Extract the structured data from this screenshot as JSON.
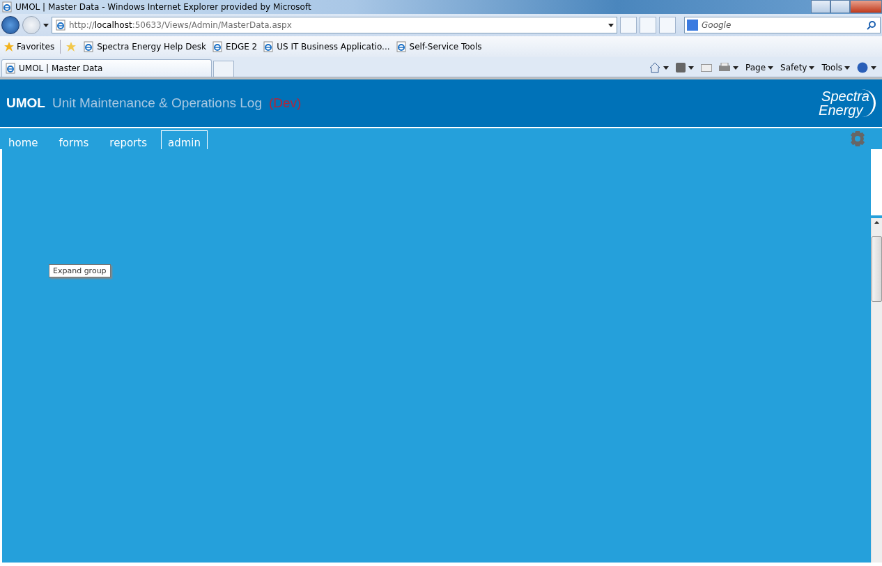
{
  "window": {
    "title": "UMOL | Master Data - Windows Internet Explorer provided by Microsoft"
  },
  "address_bar": {
    "url_prefix": "http://",
    "url_host": "localhost",
    "url_rest": ":50633/Views/Admin/MasterData.aspx"
  },
  "search": {
    "placeholder": "Google"
  },
  "favorites_bar": {
    "label": "Favorites",
    "links": [
      "Spectra Energy Help Desk",
      "EDGE 2",
      "US IT Business Applicatio...",
      "Self-Service Tools"
    ]
  },
  "tabs": [
    {
      "label": "UMOL | Master Data",
      "selected": true
    }
  ],
  "command_bar": [
    "Page",
    "Safety",
    "Tools"
  ],
  "app": {
    "brand": "UMOL",
    "title": "Unit Maintenance & Operations Log",
    "environment": "(Dev)",
    "logo_lines": [
      "Spectra",
      "Energy"
    ]
  },
  "nav": [
    {
      "label": "home",
      "selected": false
    },
    {
      "label": "forms",
      "selected": false
    },
    {
      "label": "reports",
      "selected": false
    },
    {
      "label": "admin",
      "selected": true
    }
  ],
  "tooltip": "Expand group"
}
